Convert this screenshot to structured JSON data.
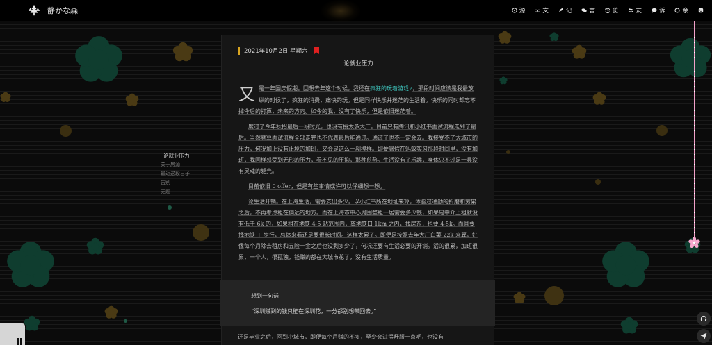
{
  "site": {
    "title": "静かな森"
  },
  "nav": [
    {
      "icon": "compass-icon",
      "label": "源"
    },
    {
      "icon": "glasses-icon",
      "label": "文"
    },
    {
      "icon": "feather-icon",
      "label": "记"
    },
    {
      "icon": "chat-icon",
      "label": "言"
    },
    {
      "icon": "history-icon",
      "label": "览"
    },
    {
      "icon": "users-icon",
      "label": "友"
    },
    {
      "icon": "message-icon",
      "label": "诉"
    },
    {
      "icon": "circle-icon",
      "label": "余"
    },
    {
      "icon": "mask-icon",
      "label": ""
    }
  ],
  "toc": [
    {
      "label": "论就业压力",
      "active": true
    },
    {
      "label": "关于房源",
      "active": false
    },
    {
      "label": "最近这段日子",
      "active": false
    },
    {
      "label": "告别",
      "active": false
    },
    {
      "label": "无题",
      "active": false
    }
  ],
  "article": {
    "date": "2021年10月2日 星期六",
    "title": "论就业压力",
    "drop_cap": "又",
    "p1_before": "是一年国庆假期。回想去年这个时候，我还在",
    "p1_link": "疯狂的玩着游戏",
    "p1_after": "，那段时间应该是我最放纵的时候了，疯狂的消费，痛快的玩。但是同样快乐并迷茫的生活着。快乐的同时却忘不掉今后的打算，未来的方向。如今的我，没有了快乐，但是依旧迷茫着。",
    "p2": "度过了今年秋招最后一段时光，也没有投太多大厂。目前只有腾讯和小红书面试流程走到了最后。当然就算面试流程全部走完也不代表最后能通过。通过了也不一定会去。我接受不了大城市的压力，何况加上没有止境的加班，又会是这么一副模样。即便暑假在蚂蚁实习那段时间里，没有加班，我同样感受到无形的压力，看不见的压抑，那种煎熬。生活没有了乐趣，身体只不过是一具没有灵魂的躯壳。",
    "p3": "目前依旧 0 offer，但是有些事情或许可以仔细想一想。",
    "p4": "论生活开销。在上海生活，需要支出多少。以小红书所在地址来算，体验过通勤的折磨和劳累之后，不再考虑租在偏远的地方。而在上海市中心周围整租一居需要多少钱，如果是中介上租就没有低于 6k 的，如果租在地铁 4-5 站范围内，离地铁口 1km 之内，找房东，也要 4-5k。而且要择地铁 + 步行，总体来看还是要很长时间。这样太累了。即便是按照去年大厂白菜 22k 来算，好像每个月除去租房和五险一金之后也没剩多少了，何况还要有生活必要的开销。活的很累，加班很累，一个人，很孤独，钱赚的都在大城市花了，没有生活质量。",
    "quote_title": "想到一句话",
    "quote_text": "“深圳赚到的钱只能在深圳花，一分都别想带回去。”",
    "tail": "还是毕业之后，回到小城市，即便每个月赚的不多，至少会过得舒服一点吧，也没有"
  },
  "colors": {
    "accent_link": "#3fc8c0",
    "date_bar": "#d9a520",
    "bookmark": "#e02020",
    "scroll_line": "#f0a0c8",
    "flower_green": "#0f3d2f",
    "flower_yellow": "#4a3a14"
  },
  "side_buttons": [
    {
      "icon": "headphones-icon"
    },
    {
      "icon": "send-icon"
    }
  ]
}
